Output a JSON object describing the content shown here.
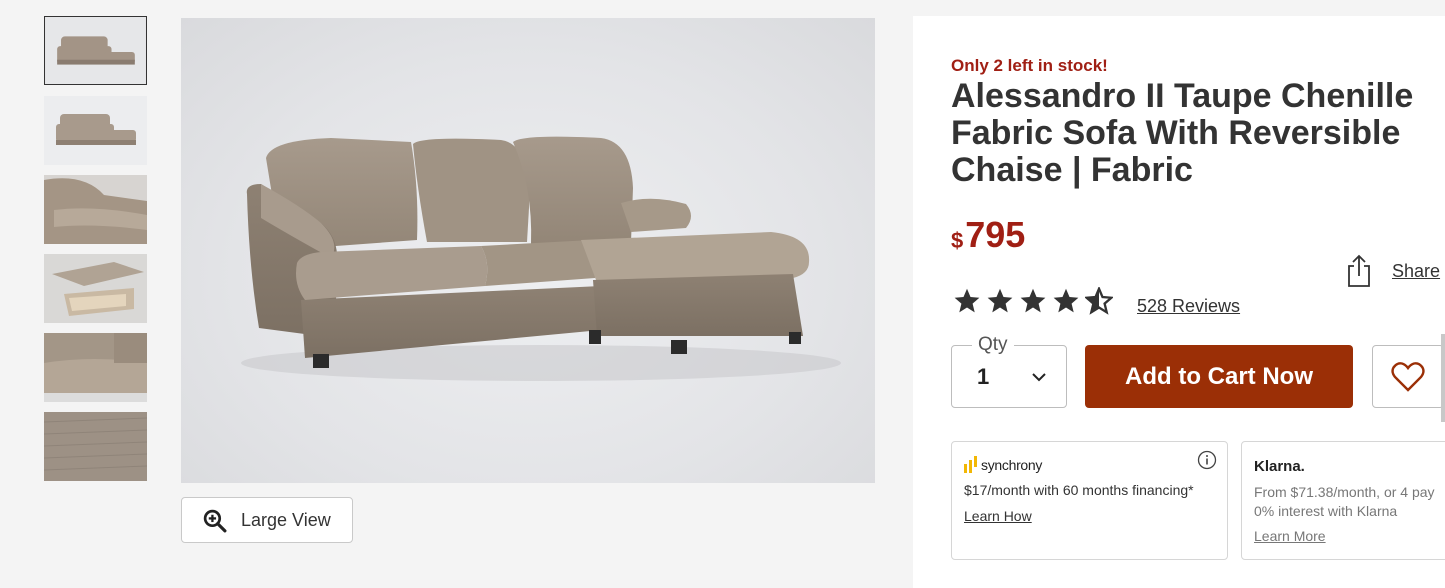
{
  "gallery": {
    "thumbnails": [
      {
        "label": "thumb-1"
      },
      {
        "label": "thumb-2"
      },
      {
        "label": "thumb-3"
      },
      {
        "label": "thumb-4"
      },
      {
        "label": "thumb-5"
      },
      {
        "label": "thumb-6"
      }
    ],
    "large_view_label": "Large View"
  },
  "product": {
    "stock_message": "Only 2 left in stock!",
    "title": "Alessandro II Taupe Chenille Fabric Sofa With Reversible Chaise | Fabric",
    "price_currency": "$",
    "price_amount": "795",
    "rating": 4.5,
    "reviews_label": "528 Reviews",
    "share_label": "Share"
  },
  "purchase": {
    "qty_label": "Qty",
    "qty_value": "1",
    "add_to_cart_label": "Add to Cart Now"
  },
  "financing": {
    "synchrony": {
      "brand": "synchrony",
      "text": "$17/month with 60 months financing*",
      "link": "Learn How"
    },
    "klarna": {
      "brand": "Klarna.",
      "text_line1": "From $71.38/month, or 4 pay",
      "text_line2": "0% interest with Klarna",
      "link": "Learn More"
    }
  },
  "colors": {
    "accent_red": "#a01f14",
    "cart_button": "#9b2f06",
    "text": "#333333"
  }
}
